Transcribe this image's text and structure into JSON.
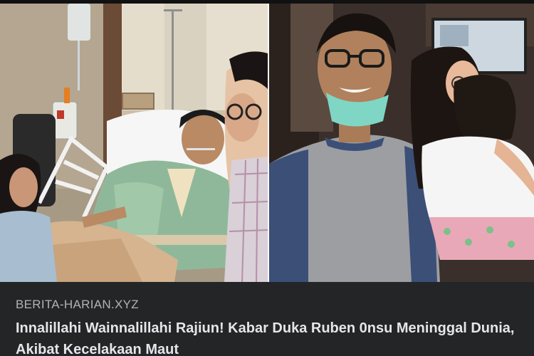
{
  "link_preview": {
    "source": "BERITA-HARIAN.XYZ",
    "headline": "Innalillahi Wainnalillahi Rajiun! Kabar Duka Ruben 0nsu Meninggal Dunia, Akibat Kecelakaan Maut"
  },
  "images": {
    "left": "hospital-bed-photo",
    "right": "man-with-mask-and-family-photo"
  },
  "colors": {
    "caption_bg": "#242526",
    "source_text": "#b0b3b8",
    "headline_text": "#e4e6eb"
  }
}
